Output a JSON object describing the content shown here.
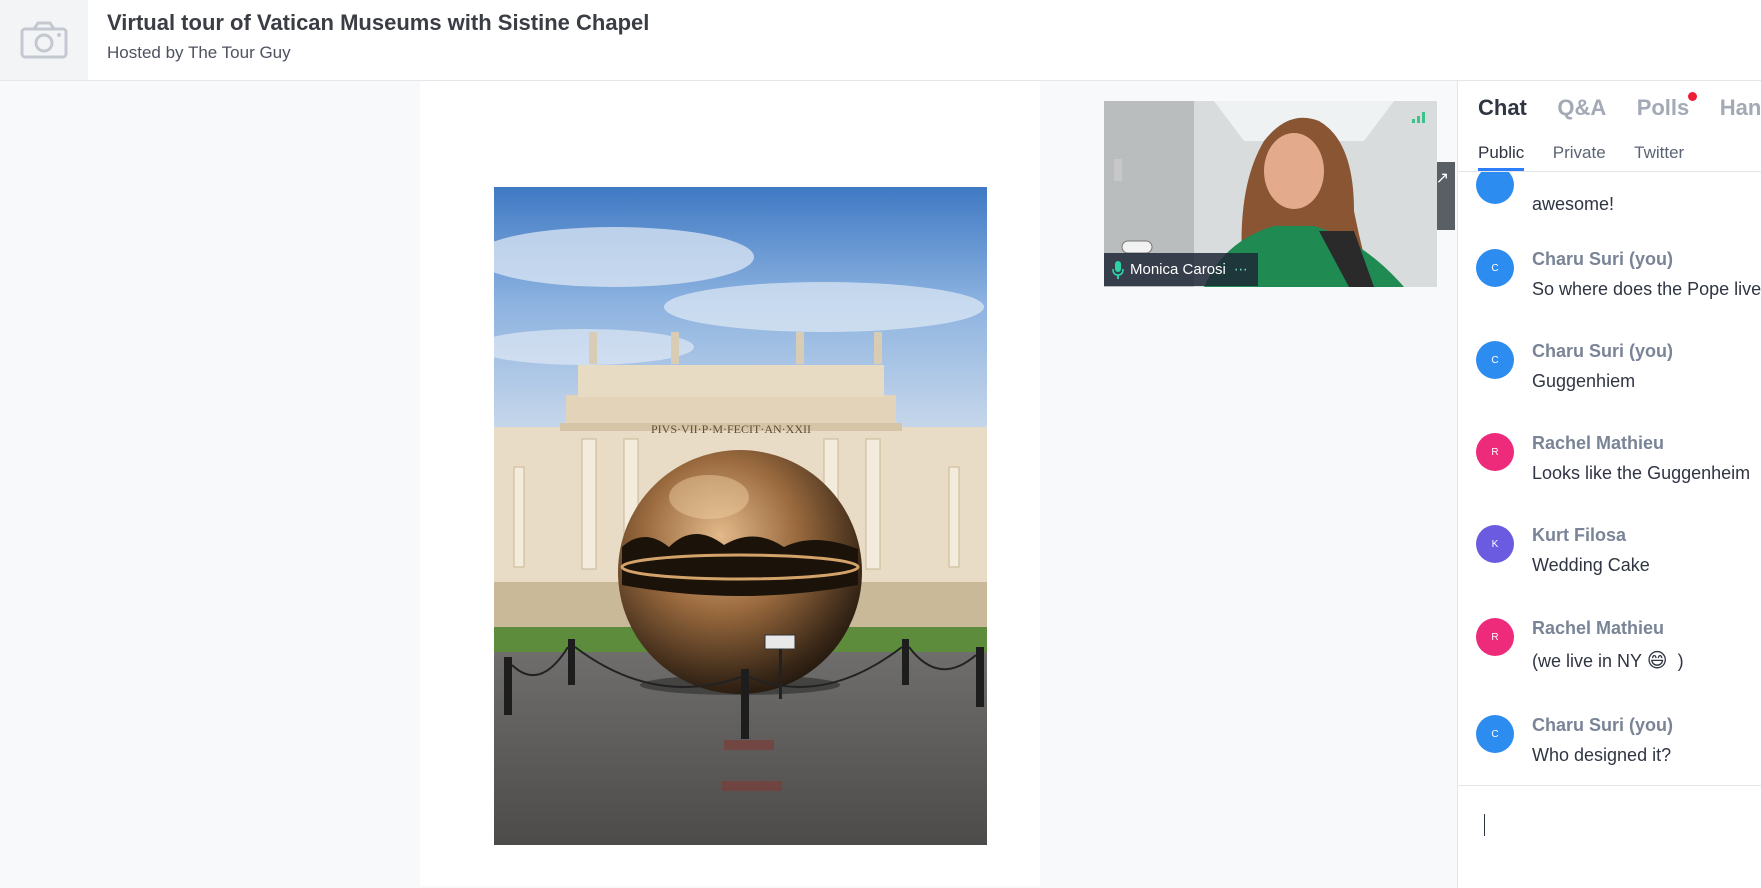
{
  "event": {
    "title": "Virtual tour of Vatican Museums with Sistine Chapel",
    "host_line": "Hosted by The Tour Guy"
  },
  "slide": {
    "inscription": "PIVS·VII·P·M·FECIT·AN·XXII"
  },
  "video": {
    "speaker_name": "Monica Carosi"
  },
  "panel": {
    "tabs": [
      {
        "label": "Chat",
        "active": true
      },
      {
        "label": "Q&A",
        "active": false
      },
      {
        "label": "Polls",
        "active": false,
        "notification": true
      },
      {
        "label": "Handouts",
        "active": false
      }
    ],
    "subtabs": [
      {
        "label": "Public",
        "active": true
      },
      {
        "label": "Private",
        "active": false
      },
      {
        "label": "Twitter",
        "active": false
      }
    ],
    "messages": [
      {
        "author": "",
        "text": "awesome!",
        "avatar_color": "#2d8cf0",
        "initial": "C"
      },
      {
        "author": "Charu Suri (you)",
        "text": "So where does the Pope live?",
        "avatar_color": "#2d8cf0",
        "initial": "C"
      },
      {
        "author": "Charu Suri (you)",
        "text": "Guggenhiem",
        "avatar_color": "#2d8cf0",
        "initial": "C"
      },
      {
        "author": "Rachel Mathieu",
        "text": "Looks like the Guggenheim",
        "avatar_color": "#ee2a7b",
        "initial": "R"
      },
      {
        "author": "Kurt Filosa",
        "text": "Wedding Cake",
        "avatar_color": "#6b5be0",
        "initial": "K"
      },
      {
        "author": "Rachel Mathieu",
        "text": "(we live in NY",
        "text_after": ")",
        "emoji": "😄",
        "avatar_color": "#ee2a7b",
        "initial": "R"
      },
      {
        "author": "Charu Suri (you)",
        "text": "Who designed it?",
        "avatar_color": "#2d8cf0",
        "initial": "C"
      }
    ]
  }
}
